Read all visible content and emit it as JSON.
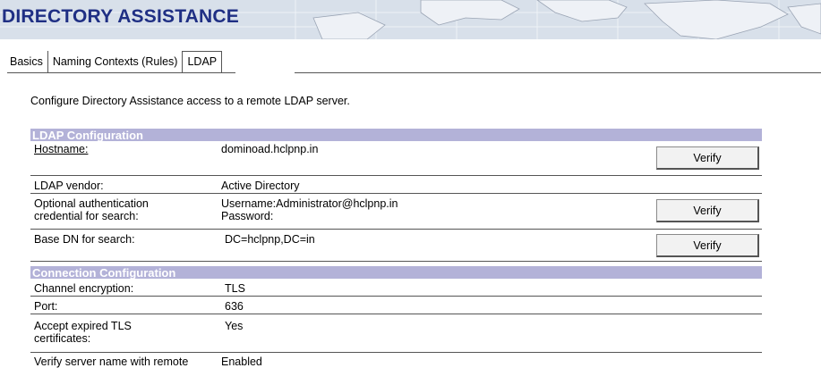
{
  "banner": {
    "title": "DIRECTORY ASSISTANCE"
  },
  "tabs": [
    {
      "label": "Basics"
    },
    {
      "label": "Naming Contexts (Rules)"
    },
    {
      "label": "LDAP"
    }
  ],
  "description": "Configure Directory Assistance access to a remote LDAP server.",
  "ldap": {
    "header": "LDAP Configuration",
    "hostname_label": "Hostname:",
    "hostname_value": "dominoad.hclpnp.in",
    "vendor_label": "LDAP vendor:",
    "vendor_value": "Active Directory",
    "cred_label_1": "Optional authentication",
    "cred_label_2": "credential for search:",
    "username_value": "Username:Administrator@hclpnp.in",
    "password_value": "Password:",
    "basedn_label": "Base DN for search:",
    "basedn_value": "DC=hclpnp,DC=in",
    "verify_label": "Verify"
  },
  "connection": {
    "header": "Connection Configuration",
    "channel_label": "Channel encryption:",
    "channel_value": "TLS",
    "port_label": "Port:",
    "port_value": "636",
    "expired_label_1": "Accept expired TLS",
    "expired_label_2": "certificates:",
    "expired_value": "Yes",
    "verifyname_label": "Verify server name with remote",
    "verifyname_value": "Enabled"
  }
}
